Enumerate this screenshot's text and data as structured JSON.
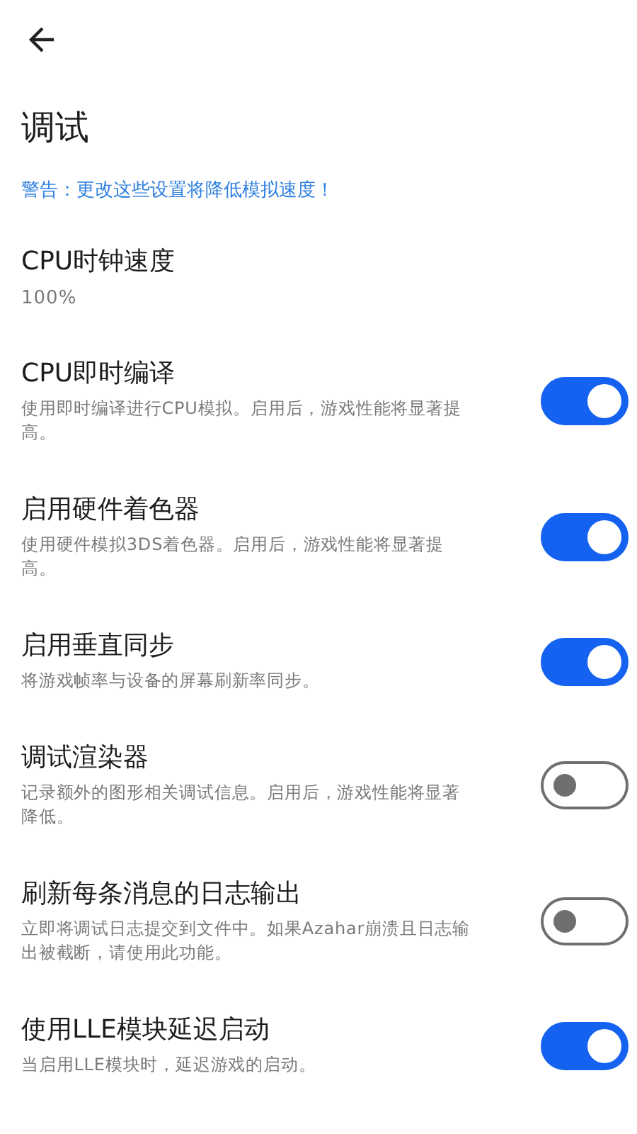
{
  "title": "调试",
  "warning": "警告：更改这些设置将降低模拟速度！",
  "settings": [
    {
      "kind": "value",
      "title": "CPU时钟速度",
      "value": "100%"
    },
    {
      "kind": "switch",
      "title": "CPU即时编译",
      "description": "使用即时编译进行CPU模拟。启用后，游戏性能将显著提高。",
      "on": true
    },
    {
      "kind": "switch",
      "title": "启用硬件着色器",
      "description": "使用硬件模拟3DS着色器。启用后，游戏性能将显著提高。",
      "on": true
    },
    {
      "kind": "switch",
      "title": "启用垂直同步",
      "description": "将游戏帧率与设备的屏幕刷新率同步。",
      "on": true
    },
    {
      "kind": "switch",
      "title": "调试渲染器",
      "description": "记录额外的图形相关调试信息。启用后，游戏性能将显著降低。",
      "on": false
    },
    {
      "kind": "switch",
      "title": "刷新每条消息的日志输出",
      "description": "立即将调试日志提交到文件中。如果Azahar崩溃且日志输出被截断，请使用此功能。",
      "on": false
    },
    {
      "kind": "switch",
      "title": "使用LLE模块延迟启动",
      "description": "当启用LLE模块时，延迟游戏的启动。",
      "on": true
    }
  ]
}
